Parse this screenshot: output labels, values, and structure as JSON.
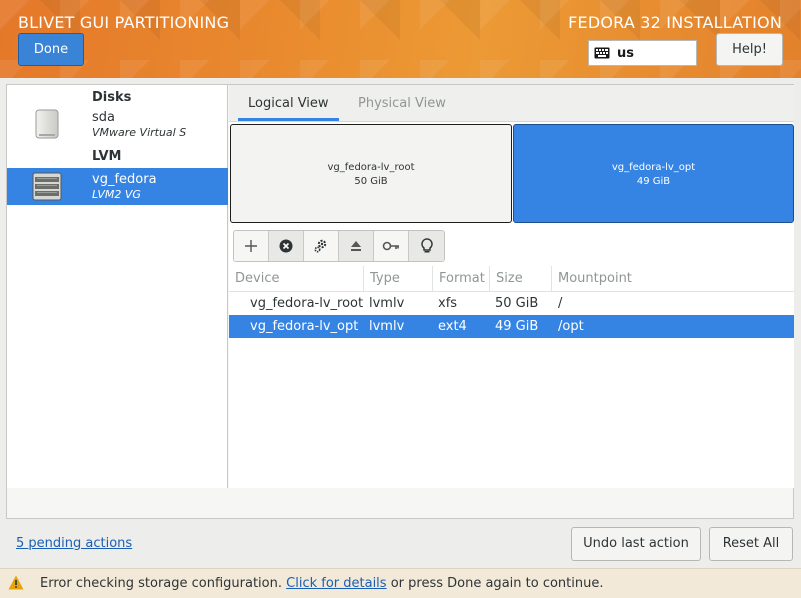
{
  "header": {
    "title": "BLIVET GUI PARTITIONING",
    "install_title": "FEDORA 32 INSTALLATION",
    "done_label": "Done",
    "keyboard_layout": "us",
    "help_label": "Help!"
  },
  "sidebar": {
    "disks_title": "Disks",
    "disks": [
      {
        "name": "sda",
        "desc": "VMware Virtual S"
      }
    ],
    "lvm_title": "LVM",
    "lvm": [
      {
        "name": "vg_fedora",
        "desc": "LVM2 VG"
      }
    ]
  },
  "tabs": {
    "logical": "Logical View",
    "physical": "Physical View"
  },
  "visualization": [
    {
      "name": "vg_fedora-lv_root",
      "size": "50 GiB"
    },
    {
      "name": "vg_fedora-lv_opt",
      "size": "49 GiB"
    }
  ],
  "toolbar": {
    "icons": [
      "add-icon",
      "delete-icon",
      "edit-icon",
      "unmount-icon",
      "decrypt-icon",
      "info-icon"
    ]
  },
  "table": {
    "columns": [
      "Device",
      "Type",
      "Format",
      "Size",
      "Mountpoint"
    ],
    "rows": [
      {
        "device": "vg_fedora-lv_root",
        "type": "lvmlv",
        "format": "xfs",
        "size": "50 GiB",
        "mountpoint": "/"
      },
      {
        "device": "vg_fedora-lv_opt",
        "type": "lvmlv",
        "format": "ext4",
        "size": "49 GiB",
        "mountpoint": "/opt"
      }
    ]
  },
  "bottom": {
    "pending_actions": "5 pending actions",
    "undo_label": "Undo last action",
    "reset_label": "Reset All"
  },
  "infobar": {
    "error_text": "Error checking storage configuration.",
    "link_text": "Click for details",
    "suffix_text": "or press Done again to continue."
  },
  "colors": {
    "accent": "#3584e4",
    "header": "#e98a2e",
    "link": "#1a5fb4"
  }
}
